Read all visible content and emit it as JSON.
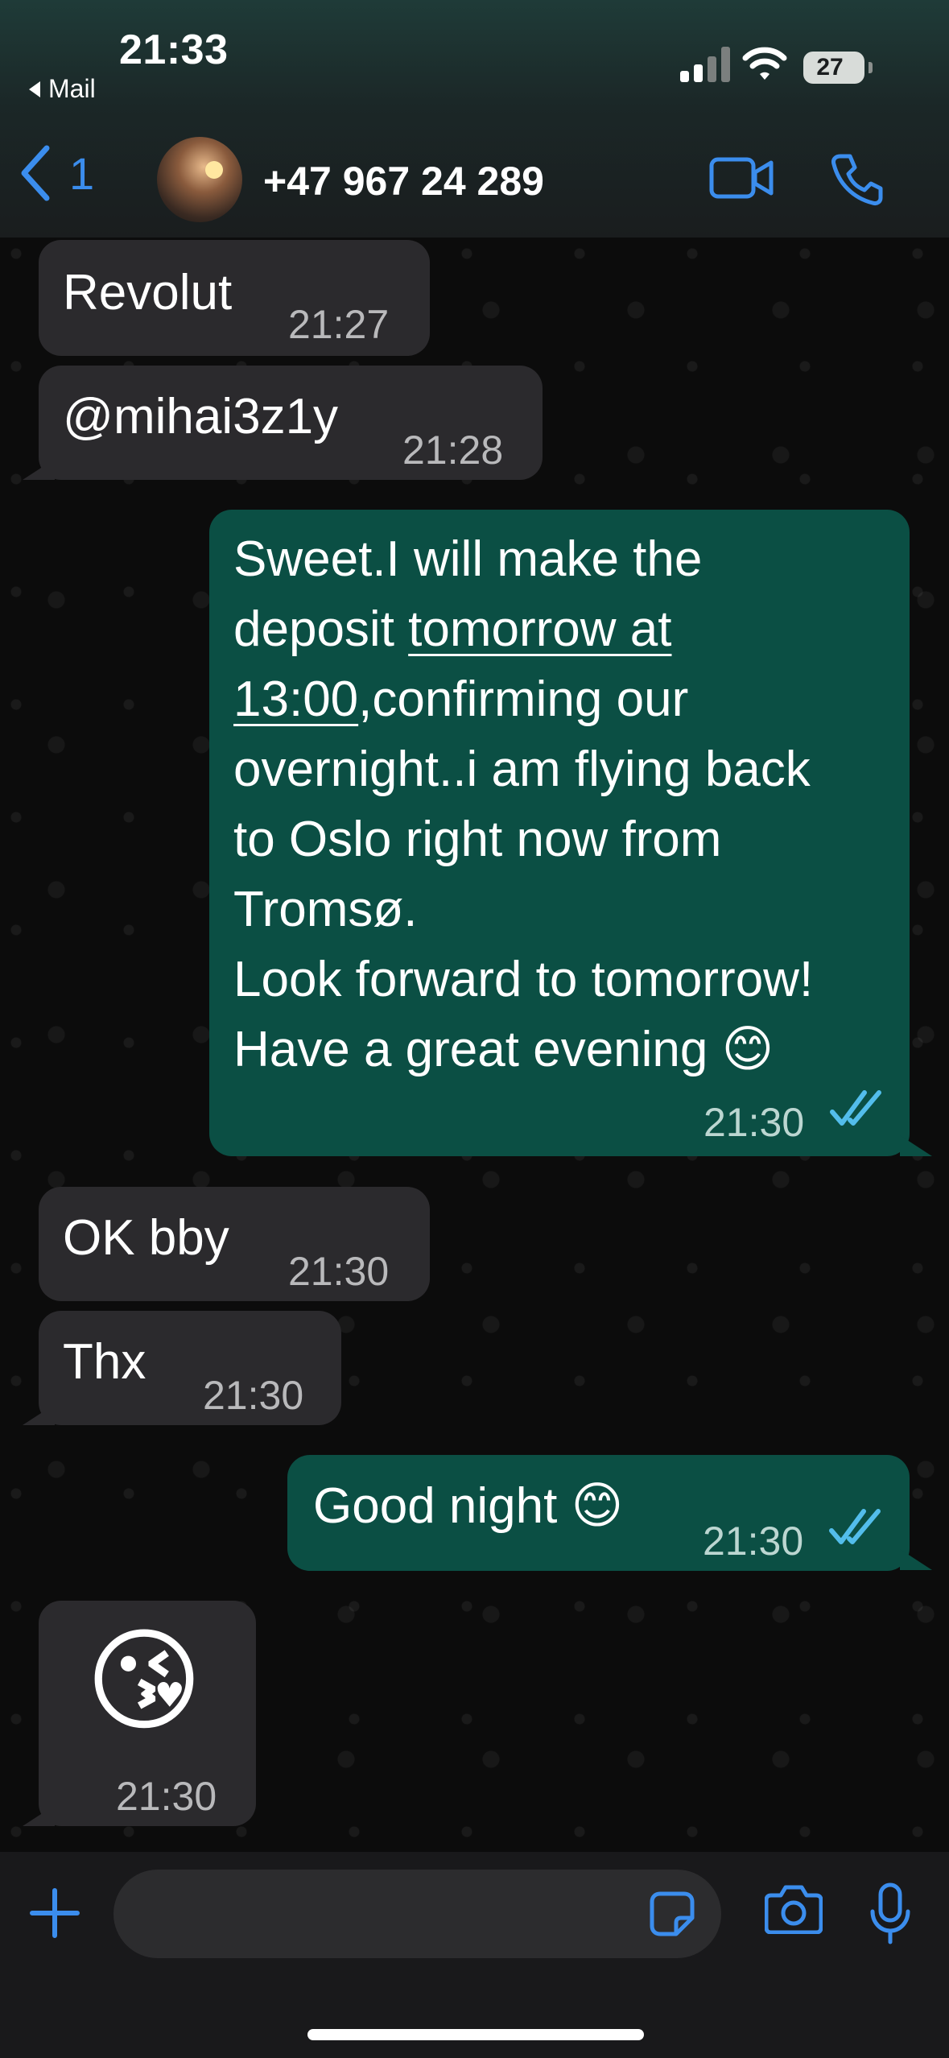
{
  "status_bar": {
    "time": "21:33",
    "back_app": "Mail",
    "battery": "27",
    "icons": [
      "signal-icon",
      "wifi-icon",
      "battery-icon"
    ]
  },
  "header": {
    "back_count": "1",
    "contact_name": "+47 967 24 289",
    "icons": [
      "back-chevron-icon",
      "video-call-icon",
      "phone-call-icon"
    ]
  },
  "messages": [
    {
      "direction": "incoming",
      "text": "Revolut",
      "time": "21:27"
    },
    {
      "direction": "incoming",
      "text": "@mihai3z1y",
      "time": "21:28"
    },
    {
      "direction": "outgoing",
      "lines": [
        "Sweet.I will make the",
        "deposit ",
        "tomorrow at",
        "13:00",
        ",confirming our",
        "overnight..i am flying back",
        "to Oslo right now from",
        "Tromsø.",
        "Look forward to tomorrow!",
        "Have a great evening 😊"
      ],
      "time": "21:30",
      "status": "read"
    },
    {
      "direction": "incoming",
      "text": "OK bby",
      "time": "21:30"
    },
    {
      "direction": "incoming",
      "text": "Thx",
      "time": "21:30"
    },
    {
      "direction": "outgoing",
      "text": "Good night 😊",
      "time": "21:30",
      "status": "read"
    },
    {
      "direction": "incoming",
      "text": "😘",
      "time": "21:30"
    }
  ],
  "composer": {
    "icons": [
      "plus-icon",
      "sticker-icon",
      "camera-icon",
      "microphone-icon"
    ]
  },
  "colors": {
    "accent": "#3b8ded",
    "outgoing_bubble": "#0b4f44",
    "incoming_bubble": "#2b2a2d",
    "read_ticks": "#53bdeb"
  }
}
